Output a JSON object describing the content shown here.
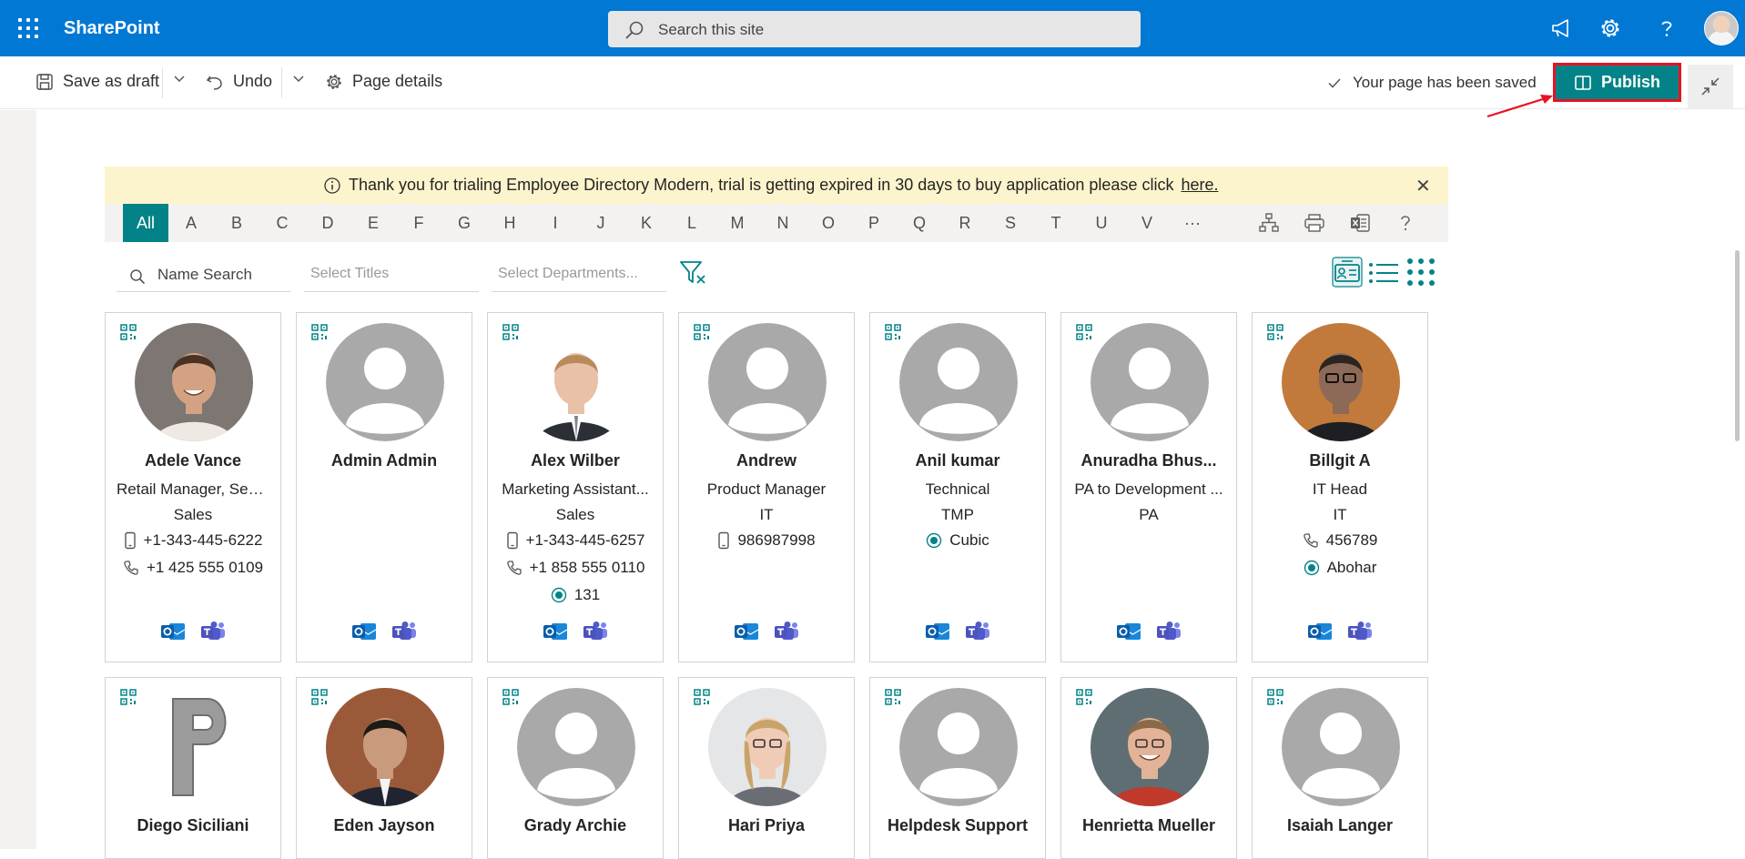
{
  "suite": {
    "app_title": "SharePoint",
    "search_placeholder": "Search this site"
  },
  "command_bar": {
    "save_draft": "Save as draft",
    "undo": "Undo",
    "page_details": "Page details",
    "saved_status": "Your page has been saved",
    "publish": "Publish"
  },
  "banner": {
    "message": "Thank you for trialing Employee Directory Modern, trial is getting expired in 30 days to buy application please click",
    "link": "here."
  },
  "alphabet": [
    "All",
    "A",
    "B",
    "C",
    "D",
    "E",
    "F",
    "G",
    "H",
    "I",
    "J",
    "K",
    "L",
    "M",
    "N",
    "O",
    "P",
    "Q",
    "R",
    "S",
    "T",
    "U",
    "V"
  ],
  "more_label": "···",
  "filters": {
    "name_search": "Name Search",
    "titles": "Select Titles",
    "departments": "Select Departments..."
  },
  "colors": {
    "accent": "#038387",
    "suite_bar": "#0078d4",
    "highlight_border": "#e81123"
  },
  "people": [
    {
      "name": "Adele Vance",
      "title": "Retail Manager, Sen...",
      "dept": "Sales",
      "mobile": "+1-343-445-6222",
      "phone": "+1 425 555 0109",
      "location": "",
      "photo": "man-smiling"
    },
    {
      "name": "Admin Admin",
      "title": "",
      "dept": "",
      "mobile": "",
      "phone": "",
      "location": "",
      "photo": "placeholder"
    },
    {
      "name": "Alex Wilber",
      "title": "Marketing Assistant...",
      "dept": "Sales",
      "mobile": "+1-343-445-6257",
      "phone": "+1 858 555 0110",
      "location": "131",
      "photo": "man-suit"
    },
    {
      "name": "Andrew",
      "title": "Product Manager",
      "dept": "IT",
      "mobile": "986987998",
      "phone": "",
      "location": "",
      "photo": "placeholder"
    },
    {
      "name": "Anil kumar",
      "title": "Technical",
      "dept": "TMP",
      "mobile": "",
      "phone": "",
      "location": "Cubic",
      "photo": "placeholder"
    },
    {
      "name": "Anuradha Bhus...",
      "title": "PA to Development ...",
      "dept": "PA",
      "mobile": "",
      "phone": "",
      "location": "",
      "photo": "placeholder"
    },
    {
      "name": "Billgit A",
      "title": "IT Head",
      "dept": "IT",
      "mobile": "",
      "phone": "456789",
      "location": "Abohar",
      "photo": "man-glasses-sunset"
    }
  ],
  "people_row2": [
    {
      "name": "Diego Siciliani",
      "photo": "letter-p"
    },
    {
      "name": "Eden Jayson",
      "photo": "man-suit-wood"
    },
    {
      "name": "Grady Archie",
      "photo": "placeholder"
    },
    {
      "name": "Hari Priya",
      "photo": "woman-glasses"
    },
    {
      "name": "Helpdesk Support",
      "photo": "placeholder"
    },
    {
      "name": "Henrietta Mueller",
      "photo": "woman-smiling"
    },
    {
      "name": "Isaiah Langer",
      "photo": "placeholder"
    }
  ]
}
